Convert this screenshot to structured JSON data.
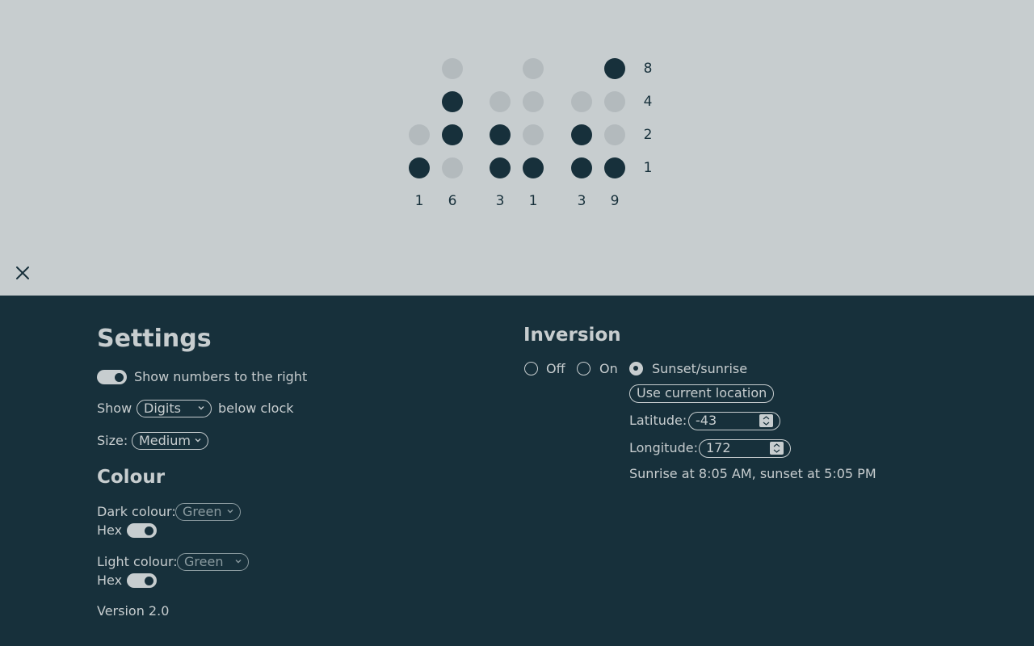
{
  "clock": {
    "columns": [
      {
        "bits": [
          null,
          null,
          false,
          true
        ],
        "digit": "1"
      },
      {
        "bits": [
          false,
          true,
          true,
          false
        ],
        "digit": "6"
      },
      {
        "bits": [
          null,
          false,
          true,
          true
        ],
        "digit": "3"
      },
      {
        "bits": [
          false,
          false,
          false,
          true
        ],
        "digit": "1"
      },
      {
        "bits": [
          null,
          false,
          true,
          true
        ],
        "digit": "3"
      },
      {
        "bits": [
          true,
          false,
          false,
          true
        ],
        "digit": "9"
      }
    ],
    "weights": [
      "8",
      "4",
      "2",
      "1"
    ],
    "colors": {
      "dark": "#17303b",
      "light": "#b3babd"
    }
  },
  "close_icon": "close-icon",
  "settings": {
    "title": "Settings",
    "show_numbers_label": "Show numbers to the right",
    "show_numbers_on": true,
    "show_prefix": "Show",
    "show_select": "Digits",
    "show_suffix": "below clock",
    "size_label": "Size:",
    "size_select": "Medium",
    "colour_title": "Colour",
    "dark_colour_label": "Dark colour:",
    "dark_colour_select": "Green",
    "dark_hex_label": "Hex",
    "dark_hex_on": true,
    "light_colour_label": "Light colour:",
    "light_colour_select": "Green",
    "light_hex_label": "Hex",
    "light_hex_on": true,
    "version": "Version 2.0"
  },
  "inversion": {
    "title": "Inversion",
    "options": [
      "Off",
      "On",
      "Sunset/sunrise"
    ],
    "selected": "Sunset/sunrise",
    "location_button": "Use current location",
    "latitude_label": "Latitude:",
    "latitude_value": "-43",
    "longitude_label": "Longitude:",
    "longitude_value": "172",
    "sun_times": "Sunrise at 8:05 AM, sunset at 5:05 PM"
  },
  "theme": {
    "panel_bg": "#17303b",
    "page_bg": "#c7cdcf"
  }
}
